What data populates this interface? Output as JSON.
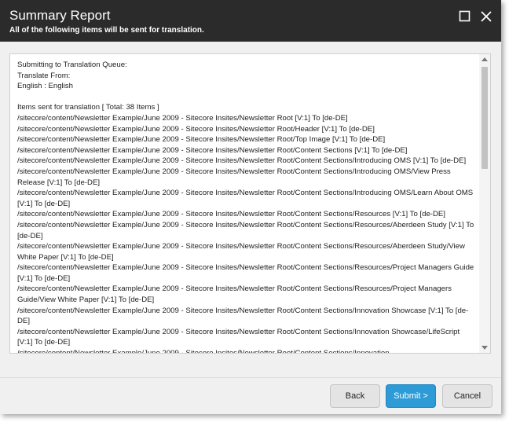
{
  "dialog": {
    "title": "Summary Report",
    "subtitle": "All of the following items will be sent for translation.",
    "colors": {
      "titlebar": "#2b2b2b",
      "submit": "#2d9bd6"
    },
    "icons": {
      "maximize": "maximize-icon",
      "close": "close-icon"
    }
  },
  "report": {
    "lines": [
      "Submitting to Translation Queue:",
      "Translate From:",
      "English : English",
      "",
      "Items sent for translation  [ Total: 38 Items ]",
      "/sitecore/content/Newsletter Example/June 2009 - Sitecore Insites/Newsletter Root [V:1] To [de-DE]",
      "/sitecore/content/Newsletter Example/June 2009 - Sitecore Insites/Newsletter Root/Header [V:1] To [de-DE]",
      "/sitecore/content/Newsletter Example/June 2009 - Sitecore Insites/Newsletter Root/Top Image [V:1] To [de-DE]",
      "/sitecore/content/Newsletter Example/June 2009 - Sitecore Insites/Newsletter Root/Content Sections [V:1] To [de-DE]",
      "/sitecore/content/Newsletter Example/June 2009 - Sitecore Insites/Newsletter Root/Content Sections/Introducing OMS [V:1] To [de-DE]",
      "/sitecore/content/Newsletter Example/June 2009 - Sitecore Insites/Newsletter Root/Content Sections/Introducing OMS/View Press Release [V:1] To [de-DE]",
      "/sitecore/content/Newsletter Example/June 2009 - Sitecore Insites/Newsletter Root/Content Sections/Introducing OMS/Learn About OMS [V:1] To [de-DE]",
      "/sitecore/content/Newsletter Example/June 2009 - Sitecore Insites/Newsletter Root/Content Sections/Resources [V:1] To [de-DE]",
      "/sitecore/content/Newsletter Example/June 2009 - Sitecore Insites/Newsletter Root/Content Sections/Resources/Aberdeen Study [V:1] To [de-DE]",
      "/sitecore/content/Newsletter Example/June 2009 - Sitecore Insites/Newsletter Root/Content Sections/Resources/Aberdeen Study/View White Paper [V:1] To [de-DE]",
      "/sitecore/content/Newsletter Example/June 2009 - Sitecore Insites/Newsletter Root/Content Sections/Resources/Project Managers Guide [V:1] To [de-DE]",
      "/sitecore/content/Newsletter Example/June 2009 - Sitecore Insites/Newsletter Root/Content Sections/Resources/Project Managers Guide/View White Paper [V:1] To [de-DE]",
      "/sitecore/content/Newsletter Example/June 2009 - Sitecore Insites/Newsletter Root/Content Sections/Innovation Showcase [V:1] To [de-DE]",
      "/sitecore/content/Newsletter Example/June 2009 - Sitecore Insites/Newsletter Root/Content Sections/Innovation Showcase/LifeScript [V:1] To [de-DE]",
      "/sitecore/content/Newsletter Example/June 2009 - Sitecore Insites/Newsletter Root/Content Sections/Innovation"
    ]
  },
  "buttons": {
    "back": "Back",
    "submit": "Submit >",
    "cancel": "Cancel"
  }
}
